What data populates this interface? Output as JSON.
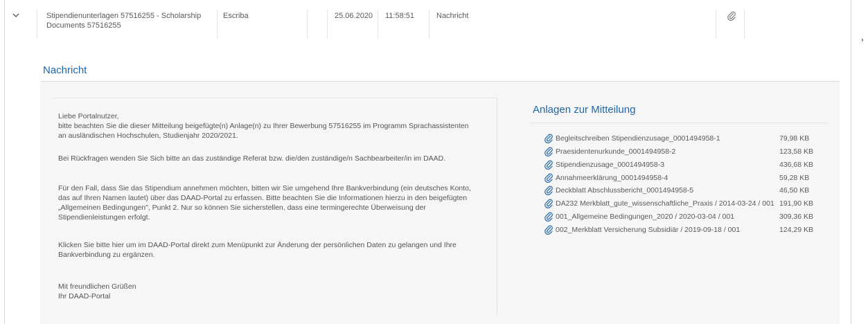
{
  "row": {
    "subject": "Stipendienunterlagen 57516255 - Scholarship Documents 57516255",
    "subject_line1": "Stipendienunterlagen 57516255 - Scholarship",
    "subject_line2": "Documents 57516255",
    "sender": "Escriba",
    "date": "25.06.2020",
    "time": "11:58:51",
    "type": "Nachricht"
  },
  "detail": {
    "heading": "Nachricht",
    "message": {
      "greeting": "Liebe Portalnutzer,",
      "p1_l1": "bitte beachten Sie die dieser Mitteilung beigefügte(n) Anlage(n) zu Ihrer Bewerbung 57516255 im Programm Sprachassistenten",
      "p1_l2": "an ausländischen Hochschulen, Studienjahr 2020/2021.",
      "p2": "Bei Rückfragen wenden Sie Sich bitte an das zuständige Referat bzw. die/den zuständige/n Sachbearbeiter/in im DAAD.",
      "p3_l1": "Für den Fall, dass Sie das Stipendium annehmen möchten, bitten wir Sie umgehend Ihre Bankverbindung (ein deutsches Konto,",
      "p3_l2": "das auf Ihren Namen lautet) über das DAAD-Portal zu erfassen. Bitte beachten Sie die Informationen hierzu in den beigefügten",
      "p3_l3": "„Allgemeinen Bedingungen\", Punkt 2. Nur so können Sie sicherstellen, dass eine termingerechte Überweisung der",
      "p3_l4": "Stipendienleistungen erfolgt.",
      "p4_l1": "Klicken Sie bitte hier um im DAAD-Portal direkt zum Menüpunkt zur Änderung der persönlichen Daten zu gelangen und Ihre",
      "p4_l2": "Bankverbindung zu ergänzen.",
      "closing": "Mit freundlichen Grüßen",
      "signature": "Ihr DAAD-Portal"
    },
    "attachments_title": "Anlagen zur Mitteilung",
    "attachments": [
      {
        "name": "Begleitschreiben Stipendienzusage_0001494958-1",
        "size": "79,98 KB"
      },
      {
        "name": "Praesidentenurkunde_0001494958-2",
        "size": "123,58 KB"
      },
      {
        "name": "Stipendienzusage_0001494958-3",
        "size": "436,68 KB"
      },
      {
        "name": "Annahmeerklärung_0001494958-4",
        "size": "59,28 KB"
      },
      {
        "name": "Deckblatt Abschlussbericht_0001494958-5",
        "size": "46,50 KB"
      },
      {
        "name": "DA232 Merkblatt_gute_wissenschaftliche_Praxis / 2014-03-24 / 001",
        "size": "191,90 KB"
      },
      {
        "name": "001_Allgemeine Bedingungen_2020 / 2020-03-04 / 001",
        "size": "309,36 KB"
      },
      {
        "name": "002_Merkblatt Versicherung Subsidiär / 2019-09-18 / 001",
        "size": "124,29 KB"
      }
    ]
  },
  "icons": {
    "expand": "chevron-down-icon",
    "attachment": "paperclip-icon",
    "scroll": "chevron-right-icon"
  },
  "colors": {
    "accent": "#1f66a6",
    "panel_bg": "#f6f6f6",
    "icon": "#2d6fa8"
  }
}
